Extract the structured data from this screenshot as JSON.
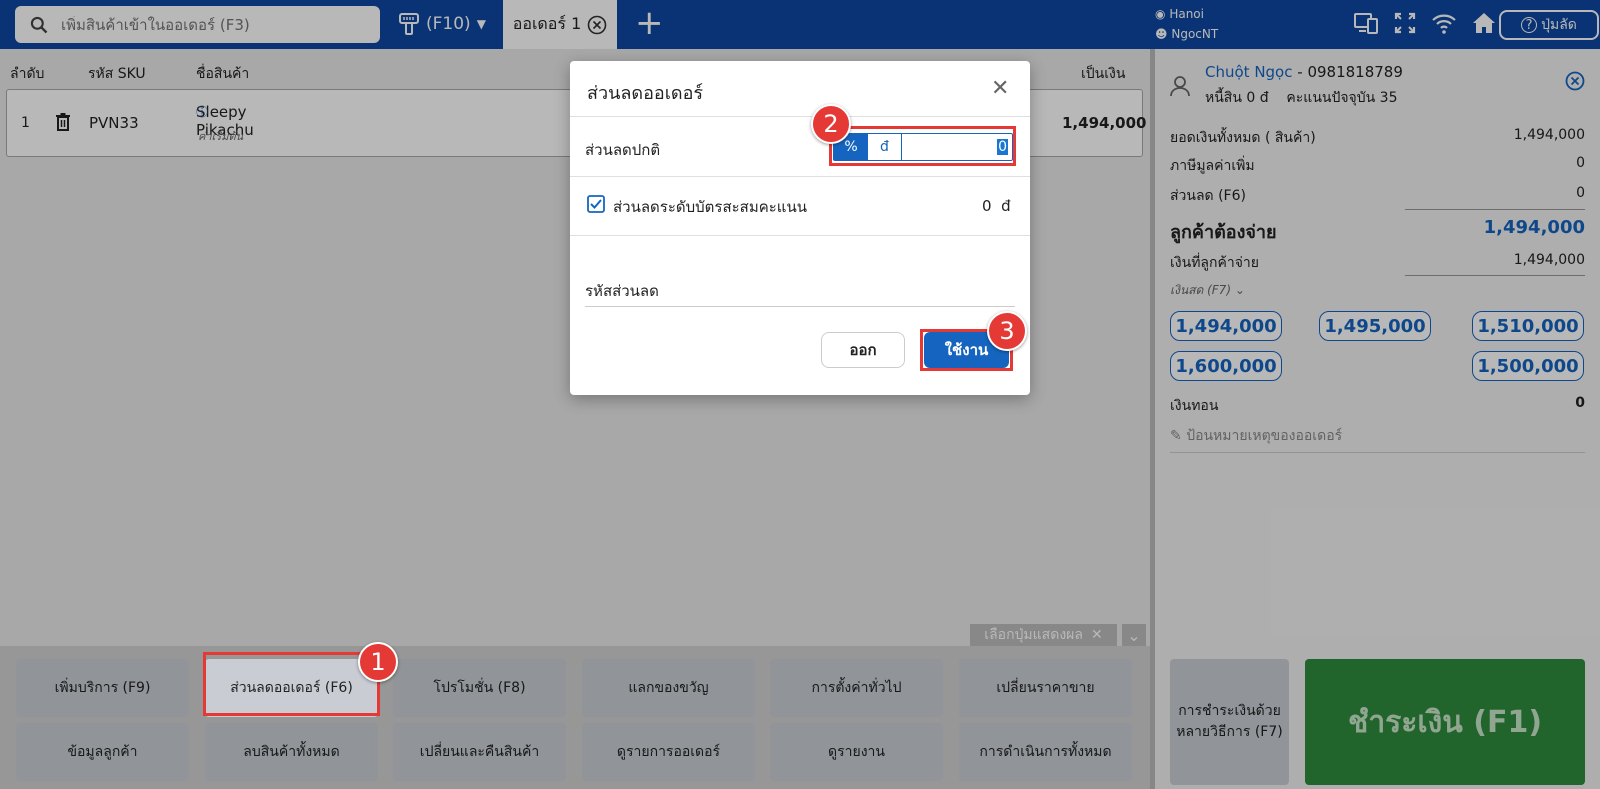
{
  "topbar": {
    "search_placeholder": "เพิ่มสินค้าเข้าในออเดอร์ (F3)",
    "scanner_label": "(F10)",
    "active_tab": "ออเดอร์ 1",
    "location": "Hanoi",
    "user": "NgocNT",
    "shortcut_label": "ปุ่มลัด"
  },
  "table": {
    "headers": {
      "index": "ลำดับ",
      "sku": "รหัส SKU",
      "name": "ชื่อสินค้า",
      "amount": "เป็นเงิน"
    },
    "rows": [
      {
        "index": "1",
        "sku": "PVN33",
        "name": "Sleepy Pikachu",
        "note": "ค่าเริ่มต้น",
        "amount": "1,494,000"
      }
    ]
  },
  "customer": {
    "name": "Chuột Ngọc",
    "phone": "- 0981818789",
    "debt": "หนี้สิน 0 đ",
    "points": "คะแนนปัจจุบัน 35"
  },
  "summary": {
    "total_label": "ยอดเงินทั้งหมด ( สินค้า)",
    "total_value": "1,494,000",
    "vat_label": "ภาษีมูลค่าเพิ่ม",
    "vat_value": "0",
    "discount_label": "ส่วนลด (F6)",
    "discount_value": "0",
    "must_pay_label": "ลูกค้าต้องจ่าย",
    "must_pay_value": "1,494,000",
    "paid_label": "เงินที่ลูกค้าจ่าย",
    "paid_value": "1,494,000",
    "method_label": "เงินสด (F7)",
    "quick_amounts": [
      "1,494,000",
      "1,495,000",
      "1,510,000",
      "1,600,000",
      "1,500,000"
    ],
    "change_label": "เงินทอน",
    "change_value": "0",
    "note_placeholder": "ป้อนหมายเหตุของออเดอร์"
  },
  "function_buttons": {
    "row1": [
      "เพิ่มบริการ (F9)",
      "ส่วนลดออเดอร์ (F6)",
      "โปรโมชั่น (F8)",
      "แลกของขวัญ",
      "การตั้งค่าทั่วไป",
      "เปลี่ยนราคาขาย"
    ],
    "row2": [
      "ข้อมูลลูกค้า",
      "ลบสินค้าทั้งหมด",
      "เปลี่ยนและคืนสินค้า",
      "ดูรายการออเดอร์",
      "ดูรายงาน",
      "การดำเนินการทั้งหมด"
    ],
    "choose_label": "เลือกปุ่มแสดงผล",
    "multi_pay": "การชำระเงินด้วยหลายวิธีการ (F7)",
    "pay": "ชำระเงิน (F1)"
  },
  "modal": {
    "title": "ส่วนลดออเดอร์",
    "normal_label": "ส่วนลดปกติ",
    "pct": "%",
    "vnd": "đ",
    "value": "0",
    "card_label": "ส่วนลดระดับบัตรสะสมคะแนน",
    "card_value": "0",
    "card_unit": "đ",
    "code_label": "รหัสส่วนลด",
    "cancel": "ออก",
    "apply": "ใช้งาน"
  },
  "annotations": [
    "1",
    "2",
    "3"
  ],
  "colors": {
    "primary": "#0d47a1",
    "accent": "#1565c0",
    "pay": "#2e8b3e",
    "highlight": "#e53935"
  }
}
